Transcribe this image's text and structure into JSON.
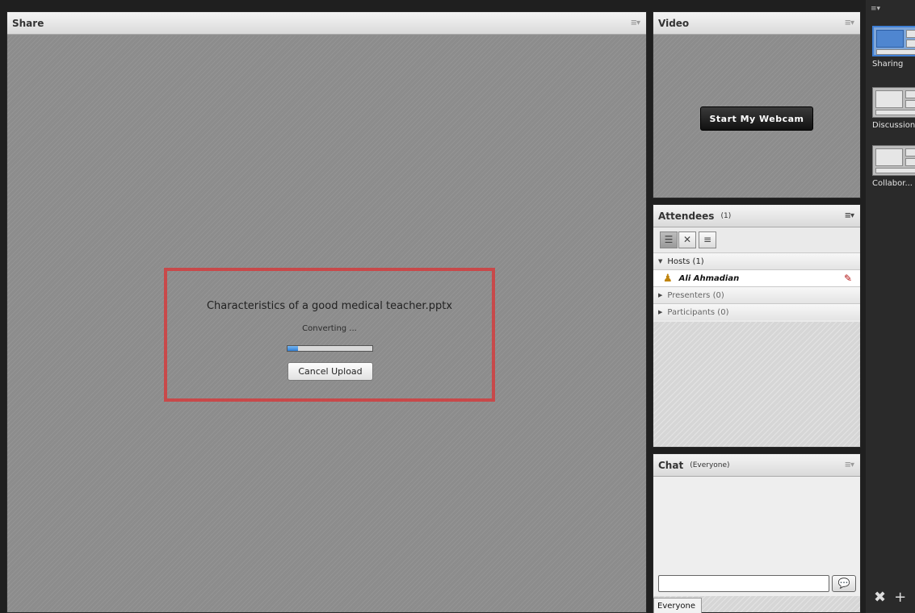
{
  "share": {
    "title": "Share",
    "upload": {
      "filename": "Characteristics of a good medical teacher.pptx",
      "status": "Converting ...",
      "progress": 0.12,
      "cancel_label": "Cancel Upload"
    }
  },
  "video": {
    "title": "Video",
    "webcam_button": "Start My Webcam"
  },
  "attendees": {
    "title": "Attendees",
    "count": "(1)",
    "groups": {
      "hosts": "Hosts (1)",
      "host_user": "Ali Ahmadian",
      "presenters": "Presenters (0)",
      "participants": "Participants (0)"
    }
  },
  "chat": {
    "title": "Chat",
    "scope": "(Everyone)",
    "input_placeholder": "",
    "tab_label": "Everyone"
  },
  "layouts": {
    "items": [
      {
        "label": "Sharing",
        "active": true
      },
      {
        "label": "Discussion",
        "active": false
      },
      {
        "label": "Collabor...",
        "active": false
      }
    ]
  },
  "colors": {
    "highlight_border": "#c8494a",
    "progress_fill": "#2f7fd6",
    "active_layout": "#3f7fd5"
  }
}
